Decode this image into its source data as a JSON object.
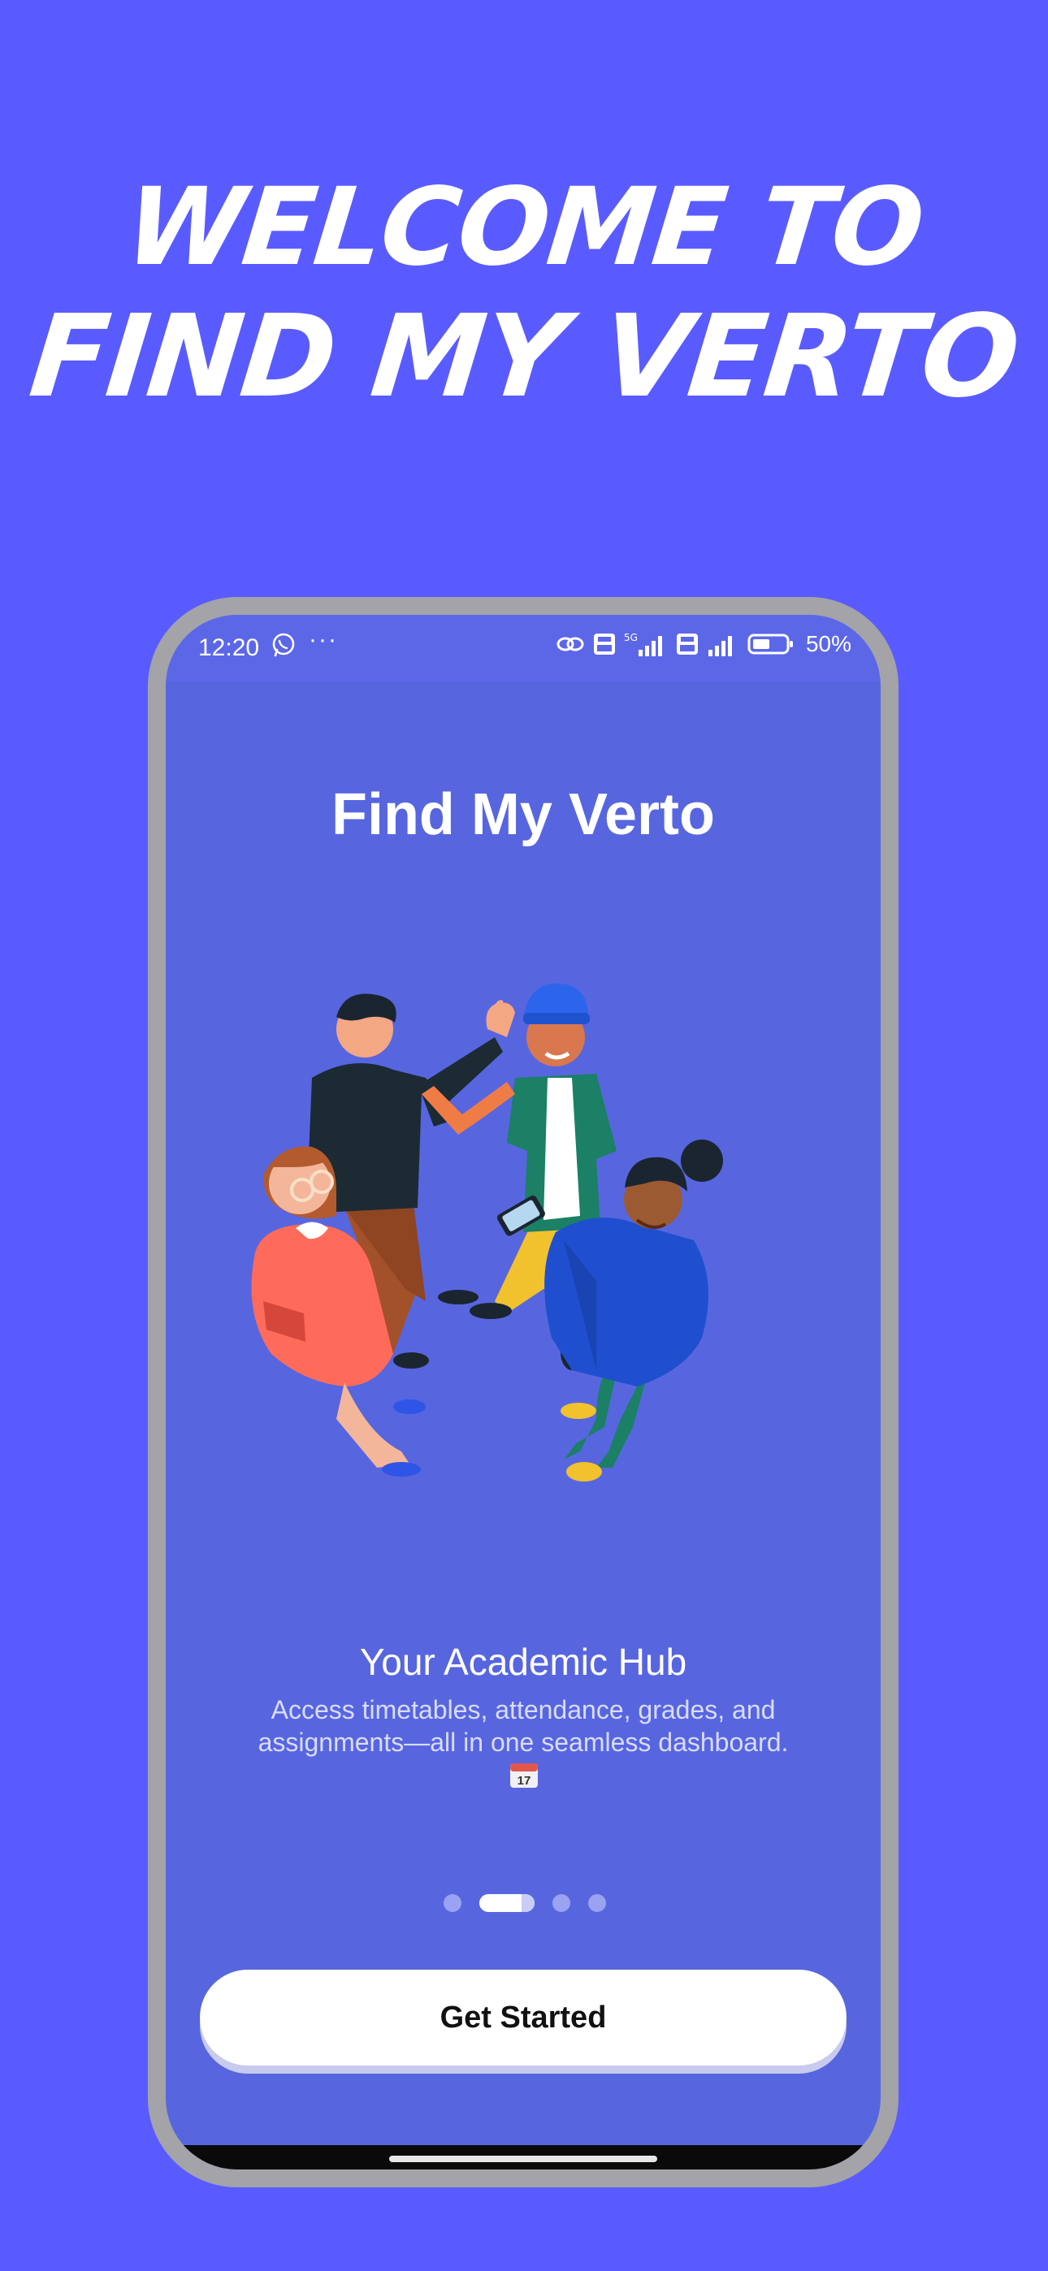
{
  "hero": {
    "line1": "Welcome to",
    "line2": "Find My Verto"
  },
  "status_bar": {
    "time": "12:20",
    "more": "···",
    "battery": "50%",
    "icons": [
      "whatsapp-icon",
      "link-icon",
      "volte-icon",
      "5g-signal-icon",
      "volte-icon",
      "signal-icon",
      "battery-icon"
    ]
  },
  "app": {
    "title": "Find My Verto",
    "slide_title": "Your Academic Hub",
    "slide_description": "Access timetables, attendance, grades, and assignments—all in one seamless dashboard.",
    "calendar_day": "17",
    "pager": {
      "total": 4,
      "active": 1
    },
    "cta_label": "Get Started"
  },
  "colors": {
    "page_background": "#5a5bff",
    "screen_background": "#5766df",
    "frame": "#a3a3a8",
    "button": "#ffffff"
  }
}
